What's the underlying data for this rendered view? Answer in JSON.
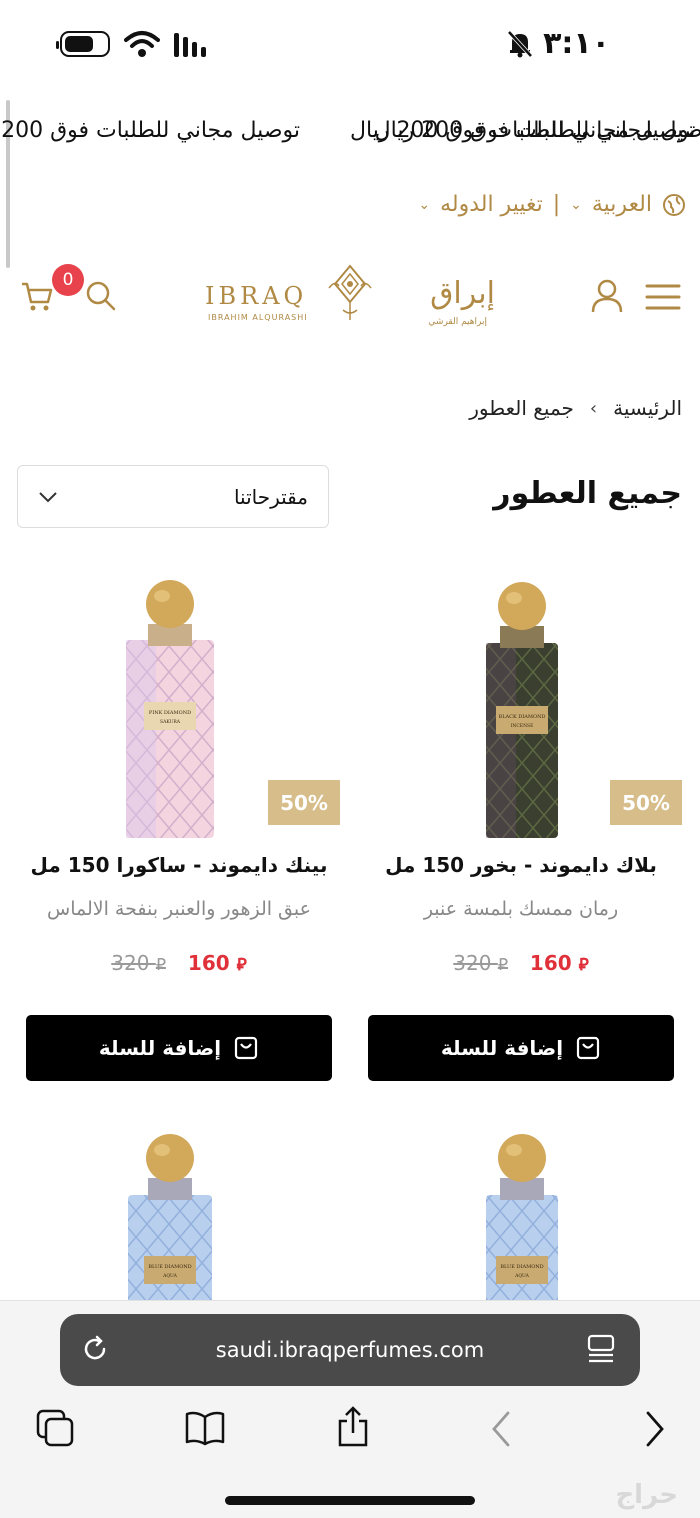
{
  "status": {
    "time": "٣:١٠"
  },
  "banner": {
    "message_a": "توصيل مجاني للطلبات فوق 200 ريال",
    "message_b": "توصيل مجاني للطلبات فوق 200 ريال",
    "message_c": "توصيل مجاني للطلبات فوق 200",
    "close_glyph": "×"
  },
  "lang": {
    "language": "العربية",
    "separator": "|",
    "change_country": "تغيير الدوله"
  },
  "header": {
    "cart_count": "0",
    "logo_latin": "IBRAQ",
    "logo_latin_sub": "IBRAHIM ALQURASHI",
    "logo_arabic": "إبراق",
    "logo_arabic_sub": "إبراهيم القرشي"
  },
  "breadcrumb": {
    "home": "الرئيسية",
    "current": "جميع العطور"
  },
  "page": {
    "title": "جميع العطور",
    "sort_value": "مقترحاتنا"
  },
  "products": [
    {
      "name": "بلاك دايموند - بخور 150 مل",
      "description": "رمان ممسك بلمسة عنبر",
      "discount": "50%",
      "price_new": "160",
      "price_old": "320",
      "add_label": "إضافة للسلة",
      "bottle_label_1": "BLACK DIAMOND",
      "bottle_label_2": "INCENSE"
    },
    {
      "name": "بينك دايموند - ساكورا 150 مل",
      "description": "عبق الزهور والعنبر بنفحة الالماس",
      "discount": "50%",
      "price_new": "160",
      "price_old": "320",
      "add_label": "إضافة للسلة",
      "bottle_label_1": "PINK DIAMOND",
      "bottle_label_2": "SAKURA"
    },
    {
      "bottle_label_1": "BLUE DIAMOND",
      "bottle_label_2": "AQUA"
    },
    {
      "bottle_label_1": "BLUE DIAMOND",
      "bottle_label_2": "AQUA"
    }
  ],
  "browser": {
    "url": "saudi.ibraqperfumes.com"
  },
  "watermark": "حراج",
  "colors": {
    "gold": "#b08a45",
    "discount_bg": "#d6bd8a",
    "price_red": "#e0313b",
    "badge_red": "#e8434d"
  }
}
